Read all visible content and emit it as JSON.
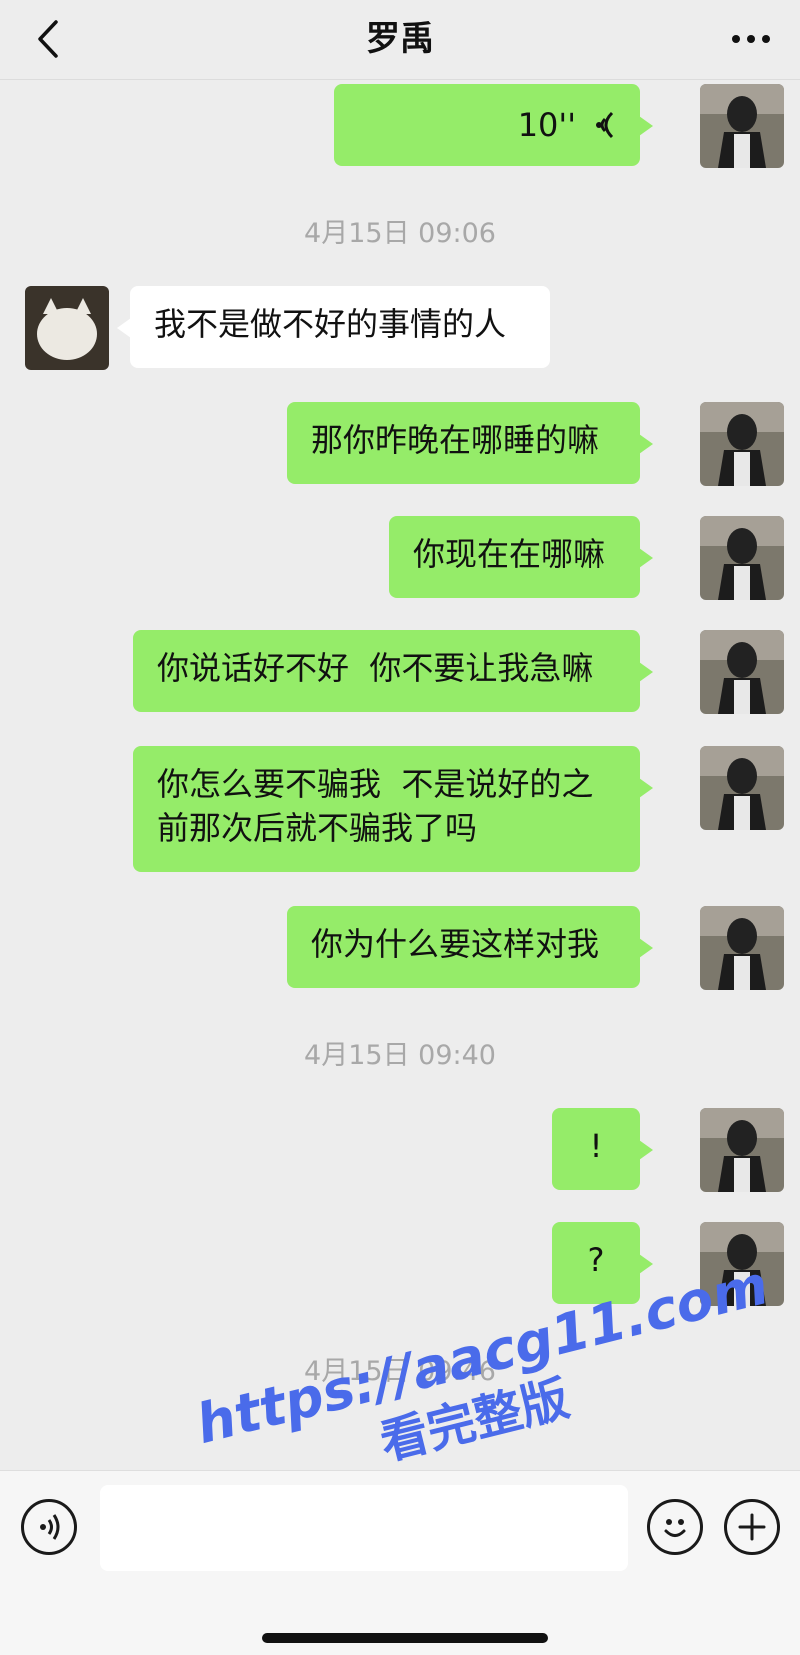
{
  "header": {
    "title": "罗禹",
    "back_icon": "chevron-left-icon",
    "more_icon": "more-dots-icon"
  },
  "messages": [
    {
      "side": "me",
      "type": "voice",
      "duration": "10''"
    },
    {
      "type": "time",
      "text": "4月15日 09:06"
    },
    {
      "side": "them",
      "text": "我不是做不好的事情的人"
    },
    {
      "side": "me",
      "text": "那你昨晚在哪睡的嘛"
    },
    {
      "side": "me",
      "text": "你现在在哪嘛"
    },
    {
      "side": "me",
      "text": "你说话好不好  你不要让我急嘛"
    },
    {
      "side": "me",
      "text": "你怎么要不骗我  不是说好的之前那次后就不骗我了吗"
    },
    {
      "side": "me",
      "text": "你为什么要这样对我"
    },
    {
      "type": "time",
      "text": "4月15日 09:40"
    },
    {
      "side": "me",
      "text": "!"
    },
    {
      "side": "me",
      "text": "?"
    },
    {
      "type": "time",
      "text": "4月15日 09:46"
    }
  ],
  "input_bar": {
    "voice_icon": "voice-input-icon",
    "emoji_icon": "emoji-icon",
    "plus_icon": "plus-icon",
    "value": ""
  },
  "watermark": {
    "line1": "https://aacg11.com",
    "line2": "看完整版"
  },
  "colors": {
    "background": "#ededed",
    "my_bubble": "#95ec69",
    "their_bubble": "#ffffff",
    "timestamp": "#a8a8a8",
    "watermark": "#4a6bea"
  }
}
